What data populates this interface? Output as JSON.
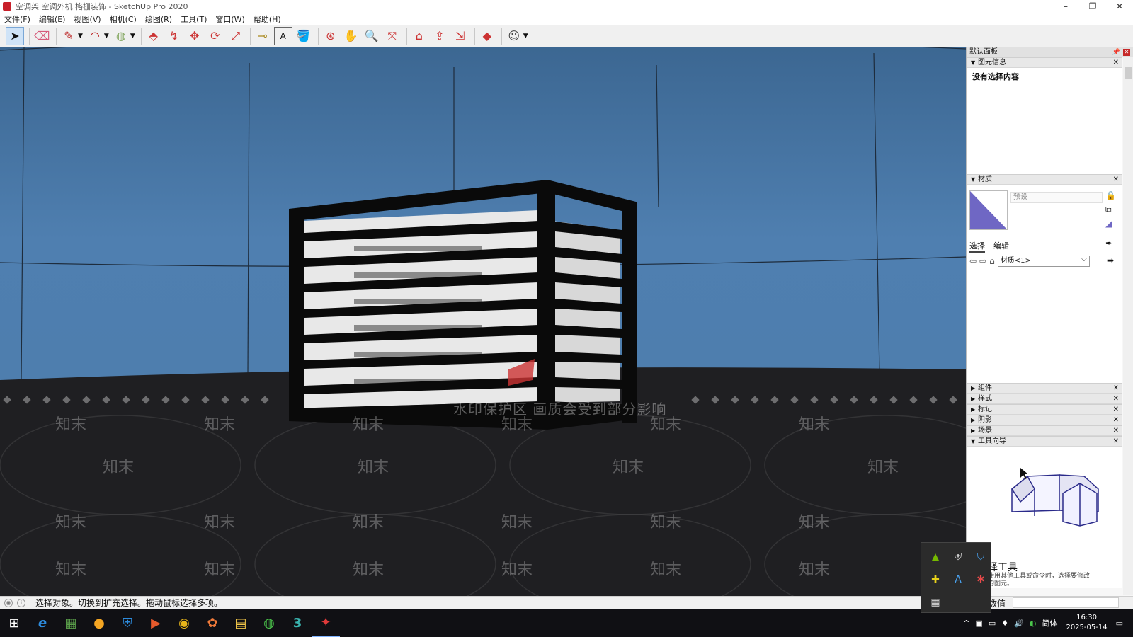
{
  "window": {
    "title": "空调架 空调外机 格栅装饰 - SketchUp Pro 2020",
    "controls": [
      "–",
      "❐",
      "✕"
    ]
  },
  "menu": [
    "文件(F)",
    "编辑(E)",
    "视图(V)",
    "相机(C)",
    "绘图(R)",
    "工具(T)",
    "窗口(W)",
    "帮助(H)"
  ],
  "toolbar": {
    "tools": [
      {
        "name": "select-tool",
        "glyph": "➤",
        "active": true
      },
      {
        "name": "eraser-tool",
        "glyph": "⌫"
      },
      {
        "name": "line-tool",
        "glyph": "✎"
      },
      {
        "name": "arc-tool",
        "glyph": "◠"
      },
      {
        "name": "shape-tool",
        "glyph": "◍"
      },
      {
        "name": "pushpull-tool",
        "glyph": "⬘"
      },
      {
        "name": "followme-tool",
        "glyph": "↯"
      },
      {
        "name": "move-tool",
        "glyph": "✥"
      },
      {
        "name": "rotate-tool",
        "glyph": "⟳"
      },
      {
        "name": "scale-tool",
        "glyph": "⤢"
      },
      {
        "name": "tape-tool",
        "glyph": "⊸"
      },
      {
        "name": "text-tool",
        "glyph": "A"
      },
      {
        "name": "paint-tool",
        "glyph": "🪣"
      },
      {
        "name": "orbit-tool",
        "glyph": "⊛"
      },
      {
        "name": "pan-tool",
        "glyph": "✋"
      },
      {
        "name": "zoom-tool",
        "glyph": "🔍"
      },
      {
        "name": "zoom-extents-tool",
        "glyph": "⤧"
      },
      {
        "name": "warehouse-tool",
        "glyph": "⌂"
      },
      {
        "name": "share-model-tool",
        "glyph": "⇪"
      },
      {
        "name": "extension-warehouse-tool",
        "glyph": "⇲"
      },
      {
        "name": "ruby-tool",
        "glyph": "◆"
      },
      {
        "name": "account-tool",
        "glyph": "☺"
      }
    ]
  },
  "viewport": {
    "watermark_banner": "水印保护区   画质会受到部分影响",
    "watermark_text": "知末"
  },
  "tray": {
    "title": "默认面板",
    "entity_info": {
      "header": "图元信息",
      "content": "没有选择内容"
    },
    "materials": {
      "header": "材质",
      "name_placeholder": "预设",
      "tab_select": "选择",
      "tab_edit": "编辑",
      "collection": "材质<1>"
    },
    "collapsed_panels": [
      "组件",
      "样式",
      "标记",
      "阴影",
      "场景"
    ],
    "tools_guide": {
      "header": "工具向导",
      "tool_title": "择工具",
      "tool_desc": "使用其他工具或命令时，选择要修改的图元。"
    }
  },
  "statusbar": {
    "text": "选择对象。切换到扩充选择。拖动鼠标选择多项。",
    "vcb_label": "数值"
  },
  "taskbar": {
    "start": "⊞",
    "apps": [
      "e",
      "▦",
      "●",
      "⛨",
      "▶",
      "◉",
      "✿",
      "▤",
      "◍",
      "3",
      "✦"
    ],
    "systray": [
      "^",
      "▣",
      "▭",
      "♦",
      "🔊",
      "◐",
      "简体"
    ],
    "time": "16:30",
    "date": "2025-05-14"
  },
  "tray_popup": {
    "icons": [
      "▲",
      "⛨",
      "⛉",
      "✚",
      "A",
      "✱",
      "▦"
    ]
  }
}
